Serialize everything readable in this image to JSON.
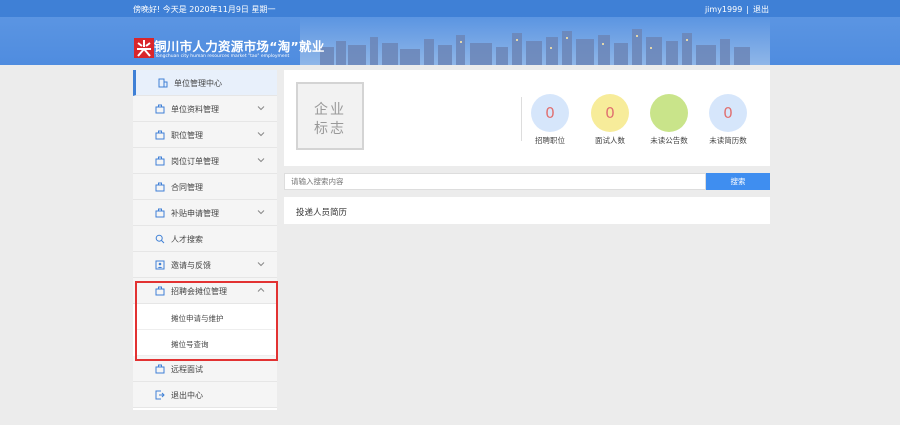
{
  "topbar": {
    "greeting": "傍晚好!  今天是 2020年11月9日 星期一",
    "username": "jimy1999",
    "separator": "|",
    "logout": "退出"
  },
  "banner": {
    "title": "铜川市人力资源市场“淘”就业",
    "subtitle": "Tongchuan city human resources market \"tao\" employment"
  },
  "sidebar": {
    "items": [
      {
        "label": "单位管理中心",
        "icon": "building-icon"
      },
      {
        "label": "单位资料管理",
        "icon": "briefcase-icon"
      },
      {
        "label": "职位管理",
        "icon": "briefcase-icon"
      },
      {
        "label": "岗位订单管理",
        "icon": "briefcase-icon"
      },
      {
        "label": "合同管理",
        "icon": "briefcase-icon"
      },
      {
        "label": "补贴申请管理",
        "icon": "briefcase-icon"
      },
      {
        "label": "人才搜索",
        "icon": "search-icon"
      },
      {
        "label": "邀请与反馈",
        "icon": "invite-icon"
      },
      {
        "label": "招聘会摊位管理",
        "icon": "briefcase-icon"
      },
      {
        "label": "远程面试",
        "icon": "briefcase-icon"
      },
      {
        "label": "退出中心",
        "icon": "logout-icon"
      }
    ],
    "sub_items": [
      {
        "label": "摊位申请与维护"
      },
      {
        "label": "摊位号查询"
      }
    ]
  },
  "enterprise_logo": {
    "line1": "企业",
    "line2": "标志"
  },
  "stats": [
    {
      "value": "0",
      "label": "招聘职位",
      "color": "#d6e6fb"
    },
    {
      "value": "0",
      "label": "面试人数",
      "color": "#f7ec9a"
    },
    {
      "value": "",
      "label": "未读公告数",
      "color": "#c9e48a"
    },
    {
      "value": "0",
      "label": "未读简历数",
      "color": "#d6e6fb"
    }
  ],
  "search": {
    "placeholder": "请输入搜索内容",
    "button_label": "搜索"
  },
  "resume_card": {
    "title": "投递人员简历"
  }
}
